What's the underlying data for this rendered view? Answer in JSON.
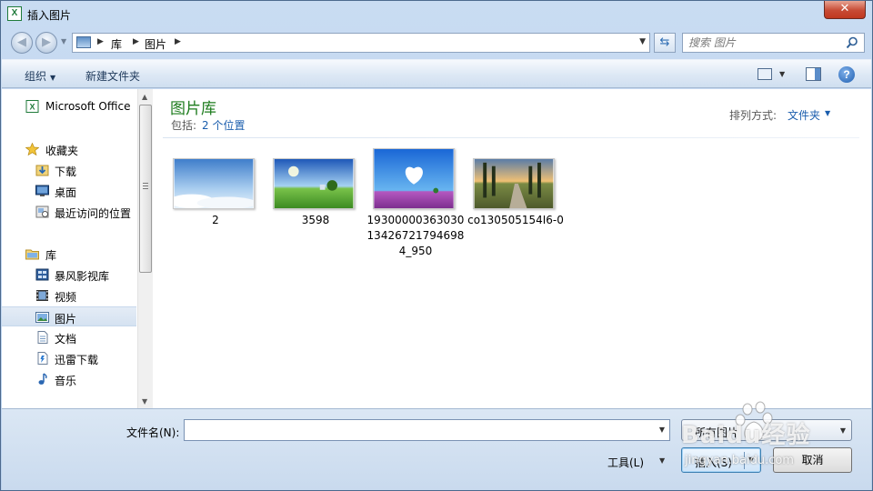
{
  "window": {
    "title": "插入图片",
    "close_label": "✕"
  },
  "address": {
    "crumbs": [
      "库",
      "图片"
    ]
  },
  "search": {
    "placeholder": "搜索 图片"
  },
  "toolbar": {
    "organize_label": "组织",
    "new_folder_label": "新建文件夹",
    "help_label": "?"
  },
  "sidebar": {
    "items": [
      {
        "label": "Microsoft Office",
        "icon": "excel-icon"
      },
      {
        "label": "收藏夹",
        "icon": "star-icon"
      },
      {
        "label": "下载",
        "icon": "download-folder-icon"
      },
      {
        "label": "桌面",
        "icon": "desktop-icon"
      },
      {
        "label": "最近访问的位置",
        "icon": "recent-places-icon"
      },
      {
        "label": "库",
        "icon": "library-icon"
      },
      {
        "label": "暴风影视库",
        "icon": "video-library-icon"
      },
      {
        "label": "视频",
        "icon": "video-icon"
      },
      {
        "label": "图片",
        "icon": "pictures-icon",
        "selected": true
      },
      {
        "label": "文档",
        "icon": "document-icon"
      },
      {
        "label": "迅雷下载",
        "icon": "thunder-download-icon"
      },
      {
        "label": "音乐",
        "icon": "music-icon"
      }
    ]
  },
  "content": {
    "library_title": "图片库",
    "includes_label": "包括:",
    "includes_link": "2 个位置",
    "arrange_label": "排列方式:",
    "arrange_value": "文件夹",
    "files": [
      {
        "name": "2"
      },
      {
        "name": "3598"
      },
      {
        "name": "19300000363030134267217946984_950"
      },
      {
        "name": "co130505154I6-0"
      }
    ]
  },
  "footer": {
    "filename_label": "文件名(N):",
    "filename_value": "",
    "filetype_value": "所有图片",
    "tools_label": "工具(L)",
    "insert_label": "插入(S)",
    "cancel_label": "取消"
  },
  "watermark": {
    "text": "Baidu经验",
    "sub": "jingyan.baidu.com"
  },
  "colors": {
    "library_title": "#1e7c1e",
    "link": "#1a5dad",
    "close_button": "#c74b35"
  }
}
